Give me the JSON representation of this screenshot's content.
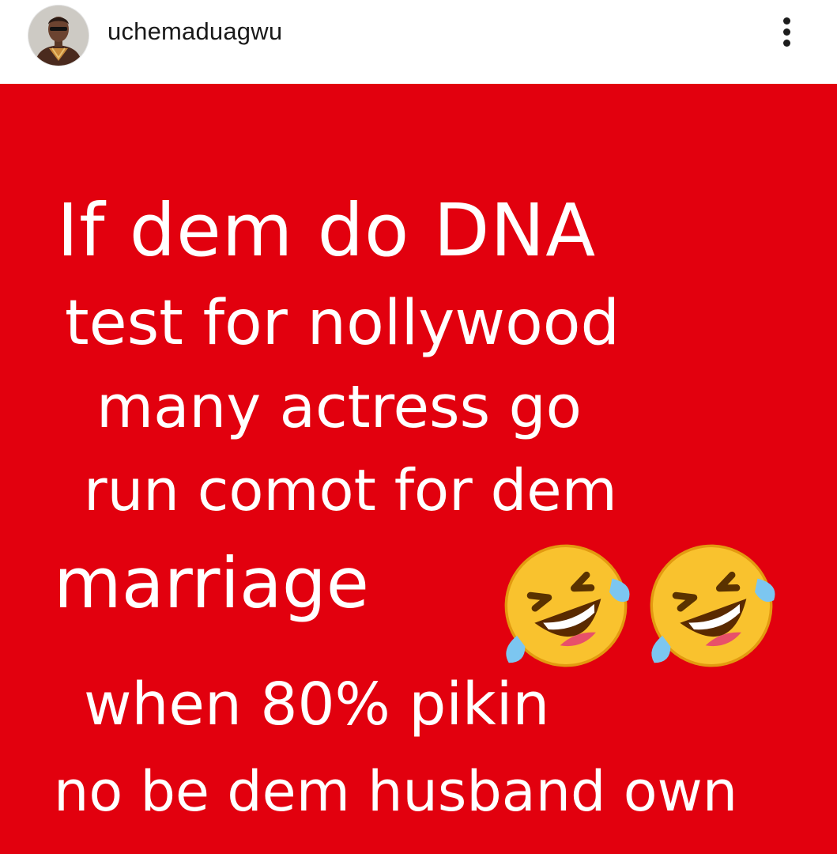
{
  "header": {
    "username": "uchemaduagwu",
    "avatar_icon": "profile-photo-icon",
    "menu_icon": "more-options-icon"
  },
  "post": {
    "background_color": "#e2000e",
    "text_color": "#ffffff",
    "lines": [
      "If dem do DNA",
      "test for nollywood",
      "many actress go",
      "run comot for dem",
      "marriage",
      "when 80% pikin",
      "no be dem husband own"
    ],
    "emojis": [
      "rolling-on-floor-laughing-icon",
      "rolling-on-floor-laughing-icon"
    ]
  }
}
